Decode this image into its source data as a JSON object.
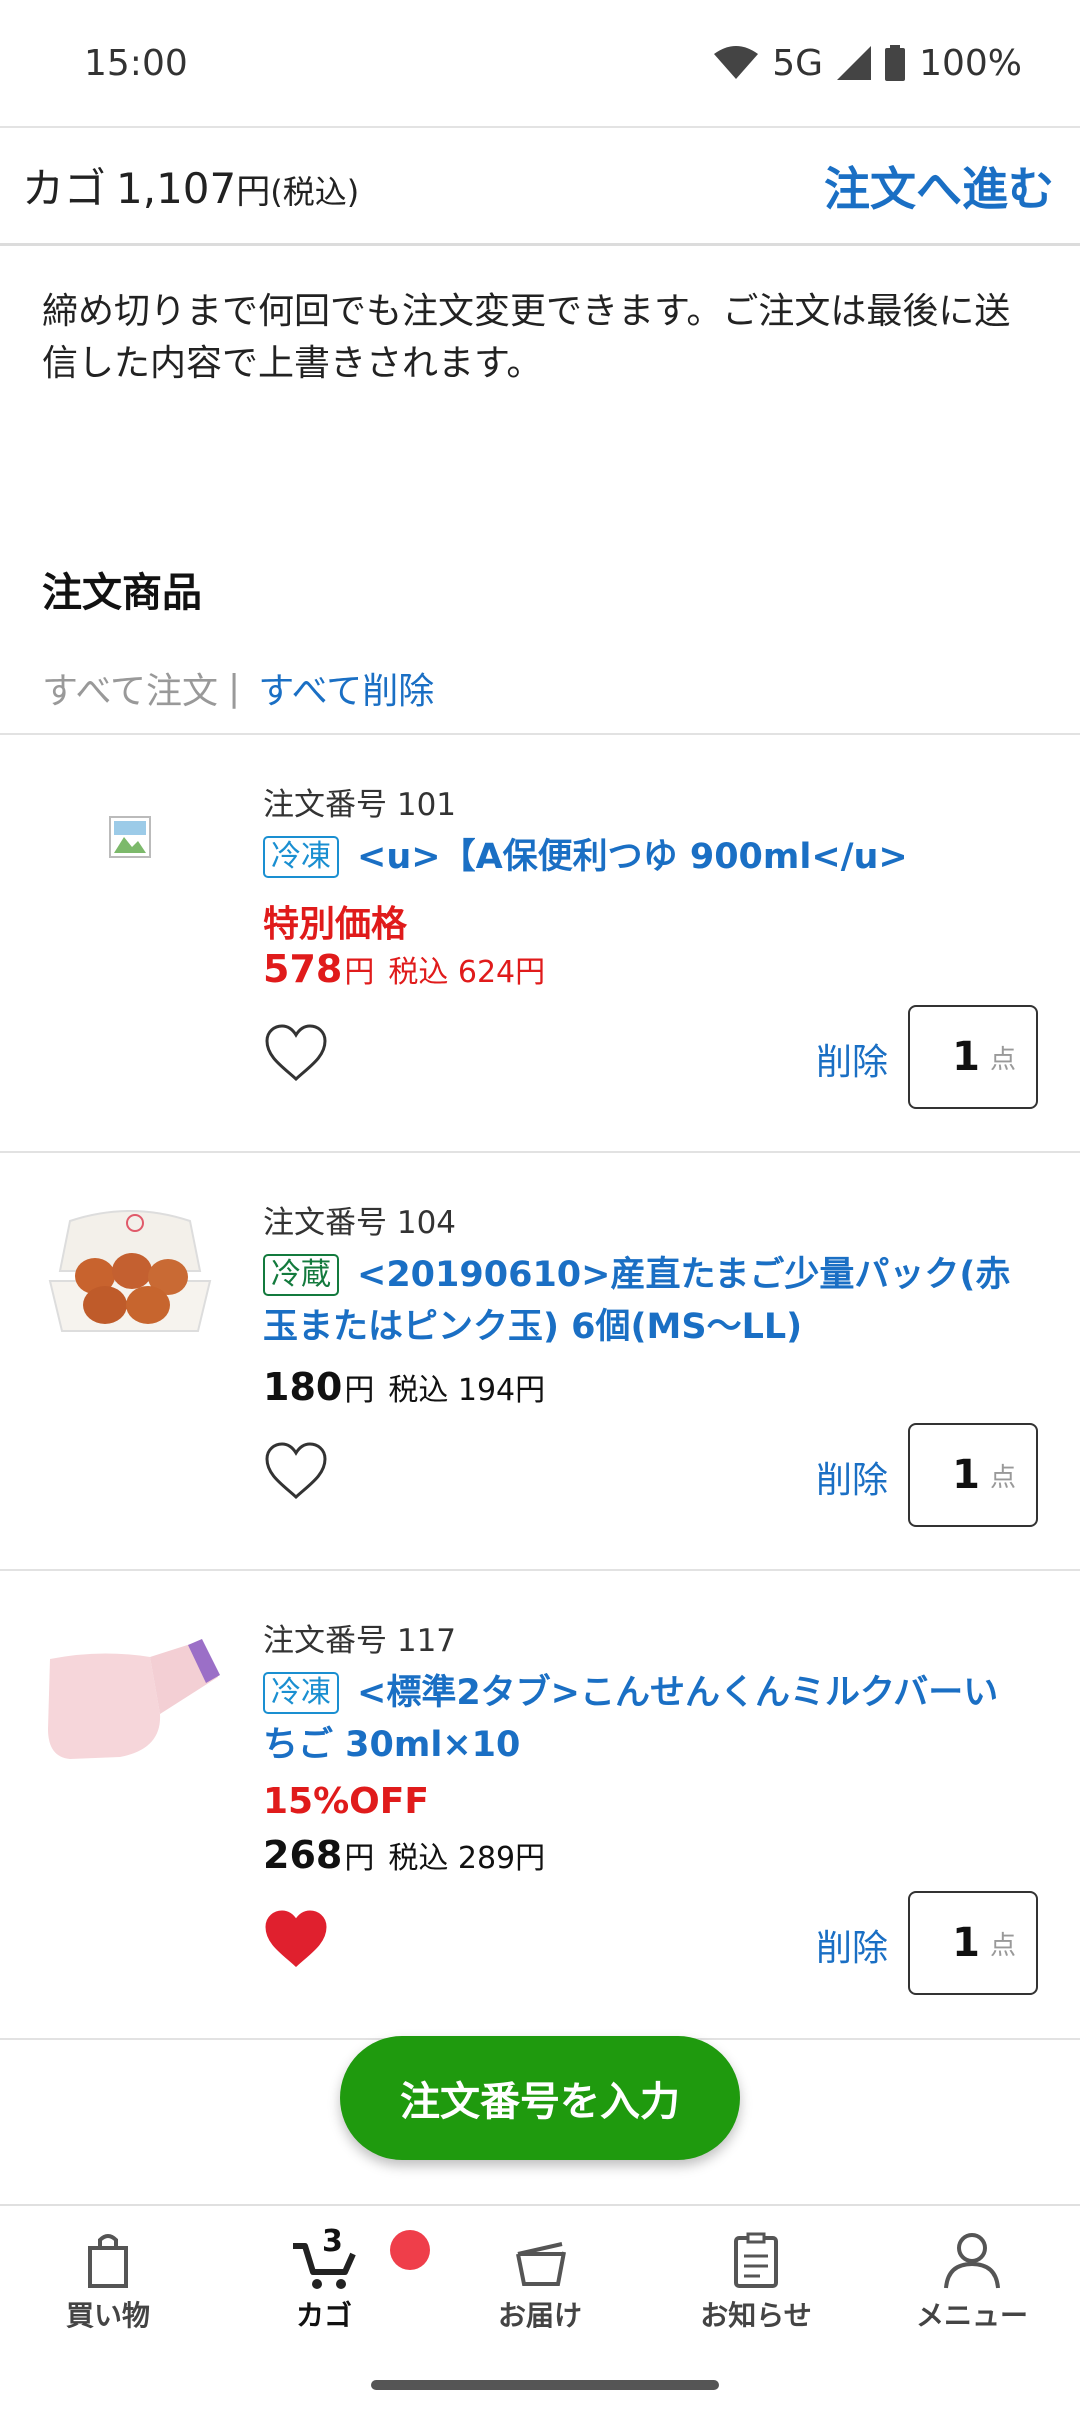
{
  "status_bar": {
    "time": "15:00",
    "network": "5G",
    "battery": "100%"
  },
  "cart": {
    "label": "カゴ",
    "total": "1,107",
    "currency": "円",
    "tax_note": "(税込)",
    "proceed_label": "注文へ進む"
  },
  "notice": "締め切りまで何回でも注文変更できます。ご注文は最後に送信した内容で上書きされます。",
  "section_title": "注文商品",
  "bulk_actions": {
    "order_all": "すべて注文",
    "separator": "|",
    "delete_all": "すべて削除"
  },
  "items": [
    {
      "order_no": "注文番号 101",
      "tag": "冷凍",
      "title": "<u>【A保便利つゆ 900ml</u>",
      "promo": "特別価格",
      "price": "578",
      "yen": "円",
      "tax_price": "税込 624円",
      "favorite": false,
      "delete_label": "削除",
      "qty": "1",
      "qty_unit": "点"
    },
    {
      "order_no": "注文番号 104",
      "tag": "冷蔵",
      "title": "<20190610>産直たまご少量パック(赤玉またはピンク玉) 6個(MS〜LL)",
      "promo": "",
      "price": "180",
      "yen": "円",
      "tax_price": "税込 194円",
      "favorite": false,
      "delete_label": "削除",
      "qty": "1",
      "qty_unit": "点"
    },
    {
      "order_no": "注文番号 117",
      "tag": "冷凍",
      "title": "<標準2タブ>こんせんくんミルクバーいちご 30ml×10",
      "promo": "15%OFF",
      "price": "268",
      "yen": "円",
      "tax_price": "税込 289円",
      "favorite": true,
      "delete_label": "削除",
      "qty": "1",
      "qty_unit": "点"
    }
  ],
  "fab_label": "注文番号を入力",
  "bottom_nav": {
    "shop": "買い物",
    "cart": "カゴ",
    "cart_count": "3",
    "delivery": "お届け",
    "news": "お知らせ",
    "menu": "メニュー"
  },
  "colors": {
    "link": "#1a6fc4",
    "promo": "#e01b1b",
    "fab": "#1f9a0e",
    "heart_active": "#e0202e"
  }
}
